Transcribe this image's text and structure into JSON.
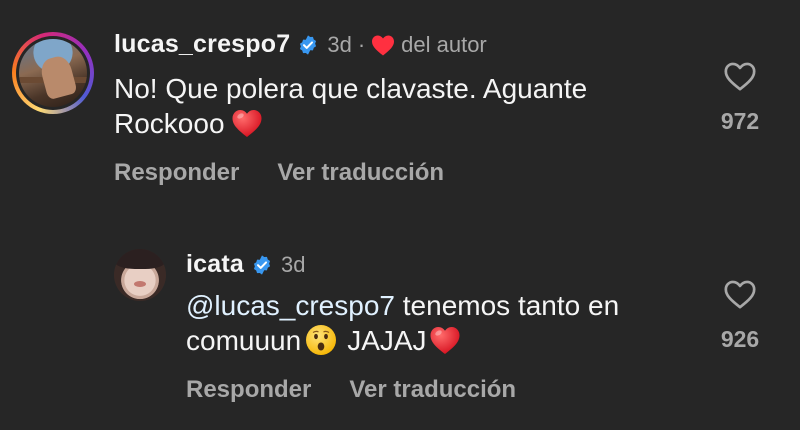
{
  "comments": [
    {
      "username": "lucas_crespo7",
      "time": "3d",
      "separator": "·",
      "author_like_label": "del autor",
      "text": "No! Que polera que clavaste. Aguante Rockooo",
      "like_count": "972",
      "reply_label": "Responder",
      "translate_label": "Ver traducción"
    },
    {
      "username": "icata",
      "time": "3d",
      "mention": "@lucas_crespo7",
      "text_part1": "tenemos tanto en",
      "text_part2": "comuuun",
      "text_part3": "JAJAJ",
      "like_count": "926",
      "reply_label": "Responder",
      "translate_label": "Ver traducción"
    }
  ],
  "icons": {
    "verified": "verified-badge-icon",
    "author_heart": "red-heart-icon",
    "like": "heart-outline-icon",
    "emoji_heart": "red-heart-emoji",
    "emoji_face": "hushed-face-emoji"
  },
  "colors": {
    "background": "#262626",
    "verified_blue": "#3897f0",
    "heart_red": "#ff3040",
    "muted": "#a8a8a8"
  }
}
